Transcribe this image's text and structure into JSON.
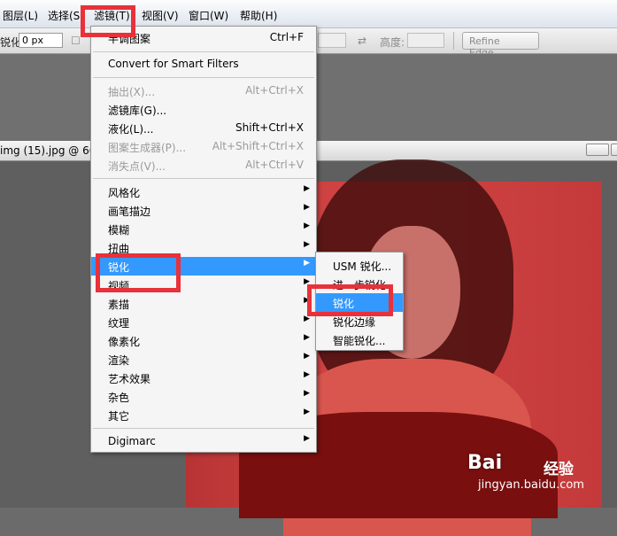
{
  "menubar": {
    "items": [
      "图层(L)",
      "选择(S)",
      "滤镜(T)",
      "视图(V)",
      "窗口(W)",
      "帮助(H)"
    ]
  },
  "options": {
    "sharpen_label": "锐化:",
    "sharpen_value": "0 px",
    "height_label": "高度:",
    "refine_edge": "Refine Edge..."
  },
  "document": {
    "title": "img (15).jpg @ 66"
  },
  "filter_menu": {
    "items": [
      {
        "label": "半调图案",
        "shortcut": "Ctrl+F"
      },
      {
        "label": "Convert for Smart Filters"
      },
      {
        "label": "抽出(X)...",
        "shortcut": "Alt+Ctrl+X",
        "disabled": true
      },
      {
        "label": "滤镜库(G)..."
      },
      {
        "label": "液化(L)...",
        "shortcut": "Shift+Ctrl+X"
      },
      {
        "label": "图案生成器(P)...",
        "shortcut": "Alt+Shift+Ctrl+X",
        "disabled": true
      },
      {
        "label": "消失点(V)...",
        "shortcut": "Alt+Ctrl+V",
        "disabled": true
      },
      {
        "label": "风格化"
      },
      {
        "label": "画笔描边"
      },
      {
        "label": "模糊"
      },
      {
        "label": "扭曲"
      },
      {
        "label": "锐化",
        "highlighted": true
      },
      {
        "label": "视频"
      },
      {
        "label": "素描"
      },
      {
        "label": "纹理"
      },
      {
        "label": "像素化"
      },
      {
        "label": "渲染"
      },
      {
        "label": "艺术效果"
      },
      {
        "label": "杂色"
      },
      {
        "label": "其它"
      },
      {
        "label": "Digimarc"
      }
    ]
  },
  "sharpen_submenu": {
    "items": [
      {
        "label": "USM 锐化..."
      },
      {
        "label": "进一步锐化"
      },
      {
        "label": "锐化",
        "highlighted": true
      },
      {
        "label": "锐化边缘"
      },
      {
        "label": "智能锐化..."
      }
    ]
  },
  "watermark": {
    "brand": "Bai",
    "brand_cn": "经验",
    "url": "jingyan.baidu.com"
  },
  "colors": {
    "highlight": "#3399ff",
    "annotation": "#e8313a",
    "photo_tint": "#c53a3a"
  }
}
